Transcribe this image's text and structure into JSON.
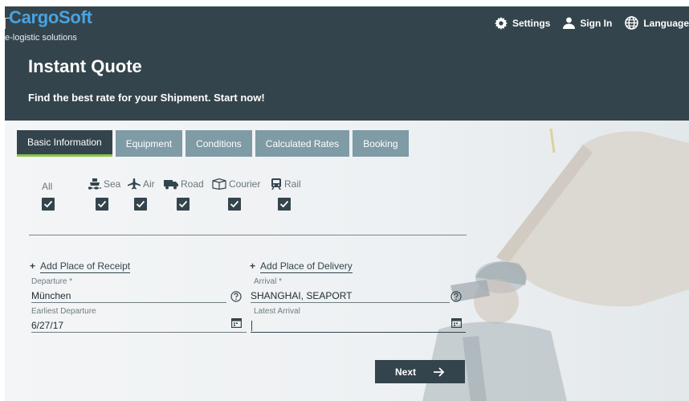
{
  "brand": {
    "name": "CargoSoft",
    "tagline": "e-logistic solutions"
  },
  "topnav": {
    "settings": "Settings",
    "sign_in": "Sign In",
    "language": "Language"
  },
  "page": {
    "title": "Instant Quote",
    "subtitle": "Find the best rate for your Shipment. Start now!"
  },
  "tabs": [
    {
      "label": "Basic Information",
      "active": true
    },
    {
      "label": "Equipment",
      "active": false
    },
    {
      "label": "Conditions",
      "active": false
    },
    {
      "label": "Calculated Rates",
      "active": false
    },
    {
      "label": "Booking",
      "active": false
    }
  ],
  "modes": [
    {
      "label": "All",
      "icon": "none",
      "checked": true
    },
    {
      "label": "Sea",
      "icon": "ship-icon",
      "checked": true
    },
    {
      "label": "Air",
      "icon": "plane-icon",
      "checked": true
    },
    {
      "label": "Road",
      "icon": "truck-icon",
      "checked": true
    },
    {
      "label": "Courier",
      "icon": "box-icon",
      "checked": true
    },
    {
      "label": "Rail",
      "icon": "train-icon",
      "checked": true
    }
  ],
  "form": {
    "add_receipt": "Add Place of Receipt",
    "add_delivery": "Add Place of Delivery",
    "departure_label": "Departure *",
    "departure_value": "München",
    "arrival_label": "Arrival *",
    "arrival_value": "SHANGHAI, SEAPORT",
    "earliest_departure_label": "Earliest Departure",
    "earliest_departure_value": "6/27/17",
    "latest_arrival_label": "Latest Arrival",
    "latest_arrival_value": ""
  },
  "actions": {
    "next": "Next"
  },
  "colors": {
    "header": "#34444c",
    "brand": "#4aa3e0",
    "tab": "#7f9ba5",
    "active_tab_underline": "#8bc34a"
  }
}
